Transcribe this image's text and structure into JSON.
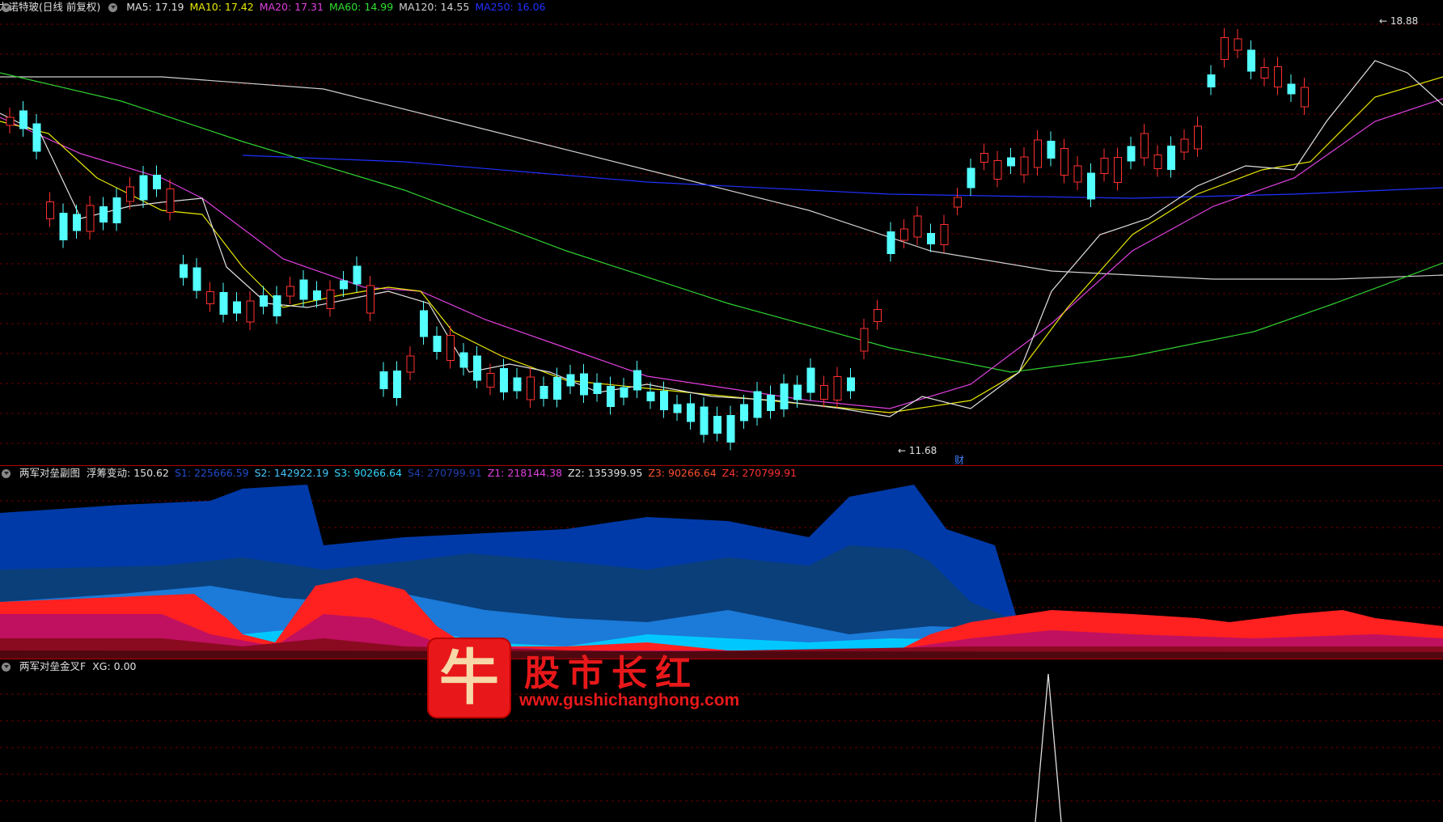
{
  "main_legend": {
    "title": "力诺特玻(日线 前复权)",
    "items": [
      {
        "label": "MA5: 17.19",
        "color": "#e0e0e0"
      },
      {
        "label": "MA10: 17.42",
        "color": "#e8e800"
      },
      {
        "label": "MA20: 17.31",
        "color": "#e040e0"
      },
      {
        "label": "MA60: 14.99",
        "color": "#30e030"
      },
      {
        "label": "MA120: 14.55",
        "color": "#d0d0d0"
      },
      {
        "label": "MA250: 16.06",
        "color": "#2030ff"
      }
    ]
  },
  "main_chart": {
    "high_label": "18.88",
    "low_label": "11.68",
    "event_marker": "财"
  },
  "sub1_legend": {
    "title": "两军对垒副图",
    "items": [
      {
        "label": "浮筹变动: 150.62",
        "color": "#e0e0e0"
      },
      {
        "label": "S1: 225666.59",
        "color": "#1e4cd0"
      },
      {
        "label": "S2: 142922.19",
        "color": "#44c8ff"
      },
      {
        "label": "S3: 90266.64",
        "color": "#30d8ff"
      },
      {
        "label": "S4: 270799.91",
        "color": "#1f3fb0"
      },
      {
        "label": "Z1: 218144.38",
        "color": "#e040e0"
      },
      {
        "label": "Z2: 135399.95",
        "color": "#e0e0e0"
      },
      {
        "label": "Z3: 90266.64",
        "color": "#ff5030"
      },
      {
        "label": "Z4: 270799.91",
        "color": "#ff3030"
      }
    ]
  },
  "sub2_legend": {
    "title": "两军对垒金叉F",
    "items": [
      {
        "label": "XG: 0.00",
        "color": "#e0e0e0"
      }
    ]
  },
  "watermark": {
    "logo_char": "牛",
    "title": "股市长红",
    "url": "www.gushichanghong.com"
  },
  "colors": {
    "up": "#ff3030",
    "down": "#54ffff",
    "grid": "#7a0000",
    "divider": "#b00000"
  }
}
